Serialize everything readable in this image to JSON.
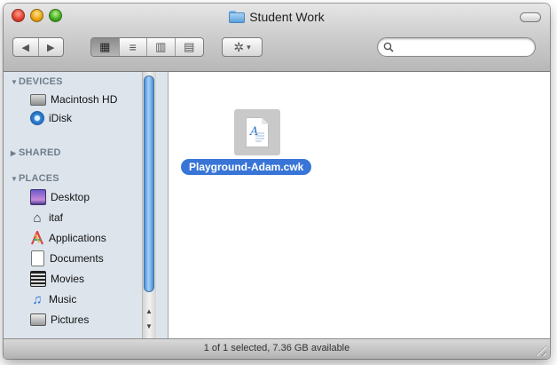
{
  "window": {
    "title": "Student Work"
  },
  "toolbar": {
    "back_glyph": "◀",
    "forward_glyph": "▶",
    "view_icons_glyph": "▦",
    "view_list_glyph": "≡",
    "view_columns_glyph": "▥",
    "view_coverflow_glyph": "▤",
    "action_glyph": "✲",
    "action_caret": "▾",
    "search_placeholder": ""
  },
  "sidebar": {
    "devices_title": "DEVICES",
    "shared_title": "SHARED",
    "places_title": "PLACES",
    "devices": [
      {
        "label": "Macintosh HD",
        "icon": "hard-drive-icon"
      },
      {
        "label": "iDisk",
        "icon": "idisk-icon"
      }
    ],
    "places": [
      {
        "label": "Desktop",
        "icon": "desktop-icon"
      },
      {
        "label": "itaf",
        "icon": "home-icon"
      },
      {
        "label": "Applications",
        "icon": "applications-icon"
      },
      {
        "label": "Documents",
        "icon": "documents-icon"
      },
      {
        "label": "Movies",
        "icon": "movies-icon"
      },
      {
        "label": "Music",
        "icon": "music-icon"
      },
      {
        "label": "Pictures",
        "icon": "pictures-icon"
      }
    ]
  },
  "content": {
    "files": [
      {
        "name": "Playground-Adam.cwk",
        "icon": "appleworks-document-icon",
        "selected": true
      }
    ]
  },
  "status": {
    "text": "1 of 1 selected, 7.36 GB available"
  },
  "colors": {
    "selection": "#3875d7",
    "sidebar_bg": "#dde4ec"
  }
}
